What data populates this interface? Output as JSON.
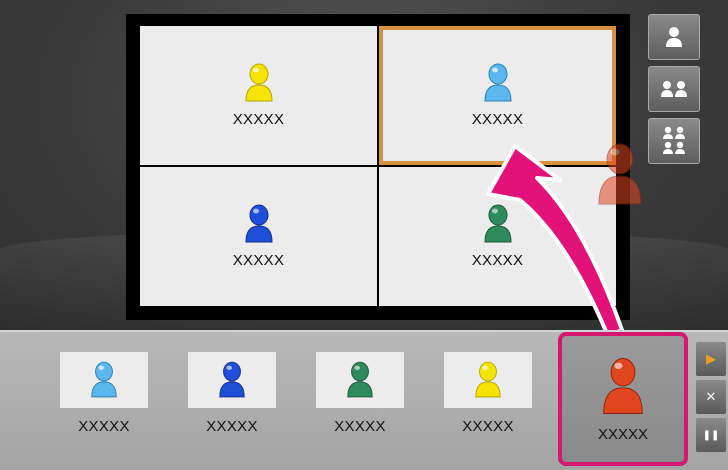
{
  "grid": {
    "cells": [
      {
        "label": "XXXXX",
        "color": "#f5e300",
        "icon": "person-yellow-icon"
      },
      {
        "label": "XXXXX",
        "color": "#5ab8ee",
        "icon": "person-lightblue-icon"
      },
      {
        "label": "XXXXX",
        "color": "#1f4fd8",
        "icon": "person-blue-icon"
      },
      {
        "label": "XXXXX",
        "color": "#2f8a5c",
        "icon": "person-green-icon"
      }
    ],
    "selected_index": 1,
    "selected_color": "#d8913f"
  },
  "layout_buttons": [
    {
      "icon": "single-person-layout-icon"
    },
    {
      "icon": "two-person-layout-icon"
    },
    {
      "icon": "four-person-layout-icon"
    }
  ],
  "dragging": {
    "color": "#e0461e",
    "icon": "person-red-icon"
  },
  "arrow_color": "#e3117a",
  "strip": {
    "thumbs": [
      {
        "label": "XXXXX",
        "color": "#5ab8ee"
      },
      {
        "label": "XXXXX",
        "color": "#1f4fd8"
      },
      {
        "label": "XXXXX",
        "color": "#2f8a5c"
      },
      {
        "label": "XXXXX",
        "color": "#f5e300"
      }
    ],
    "active": {
      "label": "XXXXX",
      "color": "#e0461e"
    },
    "active_border_color": "#d4176f"
  },
  "side_controls": {
    "play": "▶",
    "mute": "✕",
    "pause": "❚❚"
  }
}
